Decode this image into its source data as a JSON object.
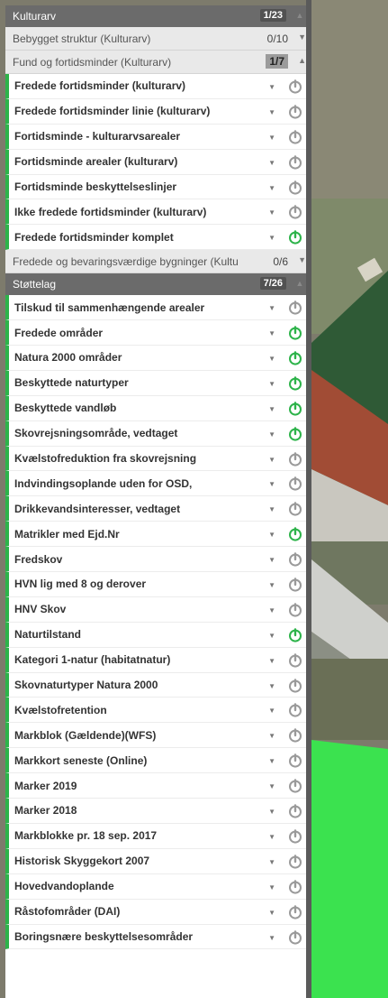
{
  "groups": [
    {
      "title": "Kulturarv",
      "count": "1/23",
      "subgroups": [
        {
          "title": "Bebygget struktur (Kulturarv)",
          "count": "0/10",
          "boxed": false,
          "expanded": false,
          "items": []
        },
        {
          "title": "Fund og fortidsminder (Kulturarv)",
          "count": "1/7",
          "boxed": true,
          "expanded": true,
          "items": [
            {
              "label": "Fredede fortidsminder (kulturarv)",
              "active": false
            },
            {
              "label": "Fredede fortidsminder linie (kulturarv)",
              "active": false
            },
            {
              "label": "Fortidsminde - kulturarvsarealer",
              "active": false
            },
            {
              "label": "Fortidsminde arealer (kulturarv)",
              "active": false
            },
            {
              "label": "Fortidsminde beskyttelseslinjer",
              "active": false
            },
            {
              "label": "Ikke fredede fortidsminder (kulturarv)",
              "active": false
            },
            {
              "label": "Fredede fortidsminder komplet",
              "active": true
            }
          ]
        },
        {
          "title": "Fredede og bevaringsværdige bygninger (Kultu",
          "count": "0/6",
          "boxed": false,
          "expanded": false,
          "items": []
        }
      ]
    },
    {
      "title": "Støttelag",
      "count": "7/26",
      "items": [
        {
          "label": "Tilskud til sammenhængende arealer",
          "active": false
        },
        {
          "label": "Fredede områder",
          "active": true
        },
        {
          "label": "Natura 2000 områder",
          "active": true
        },
        {
          "label": "Beskyttede naturtyper",
          "active": true
        },
        {
          "label": "Beskyttede vandløb",
          "active": true
        },
        {
          "label": "Skovrejsningsområde, vedtaget",
          "active": true
        },
        {
          "label": "Kvælstofreduktion fra skovrejsning",
          "active": false
        },
        {
          "label": "Indvindingsoplande uden for OSD,",
          "active": false
        },
        {
          "label": "Drikkevandsinteresser, vedtaget",
          "active": false
        },
        {
          "label": "Matrikler med Ejd.Nr",
          "active": true
        },
        {
          "label": "Fredskov",
          "active": false
        },
        {
          "label": "HVN lig med 8 og derover",
          "active": false
        },
        {
          "label": "HNV Skov",
          "active": false
        },
        {
          "label": "Naturtilstand",
          "active": true
        },
        {
          "label": "Kategori 1-natur (habitatnatur)",
          "active": false
        },
        {
          "label": "Skovnaturtyper Natura 2000",
          "active": false
        },
        {
          "label": "Kvælstofretention",
          "active": false
        },
        {
          "label": "Markblok (Gældende)(WFS)",
          "active": false
        },
        {
          "label": "Markkort seneste (Online)",
          "active": false
        },
        {
          "label": "Marker 2019",
          "active": false
        },
        {
          "label": "Marker 2018",
          "active": false
        },
        {
          "label": "Markblokke pr. 18 sep. 2017",
          "active": false
        },
        {
          "label": "Historisk Skyggekort 2007",
          "active": false
        },
        {
          "label": "Hovedvandoplande",
          "active": false
        },
        {
          "label": "Råstofområder (DAI)",
          "active": false
        },
        {
          "label": "Boringsnære beskyttelsesområder",
          "active": false
        }
      ]
    }
  ],
  "colors": {
    "active_power": "#2db34a",
    "inactive_power": "#9a9a9a",
    "row_accent": "#2db34a"
  },
  "icons": {
    "row_menu": "caret-down-icon",
    "toggle": "power-icon",
    "collapse": "chevron-icon"
  }
}
